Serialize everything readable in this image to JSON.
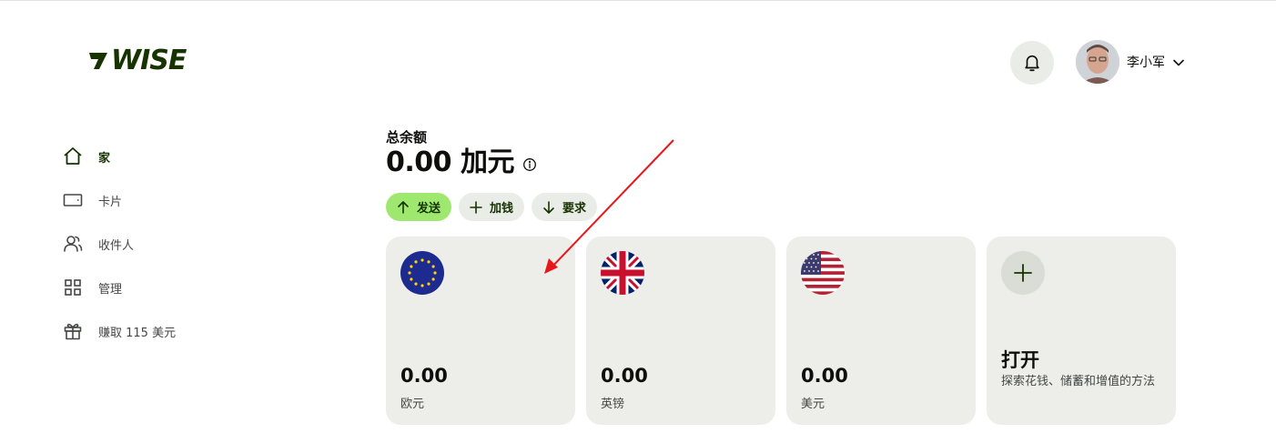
{
  "brand": {
    "name": "WISE",
    "color": "#163300",
    "accent": "#9fe870"
  },
  "header": {
    "user_name": "李小军"
  },
  "sidebar": {
    "items": [
      {
        "label": "家",
        "icon": "home-icon",
        "active": true
      },
      {
        "label": "卡片",
        "icon": "card-icon"
      },
      {
        "label": "收件人",
        "icon": "recipients-icon"
      },
      {
        "label": "管理",
        "icon": "grid-icon"
      },
      {
        "label": "赚取 115 美元",
        "icon": "gift-icon"
      }
    ]
  },
  "balance": {
    "label": "总余额",
    "amount": "0.00 加元"
  },
  "actions": {
    "send": "发送",
    "add": "加钱",
    "request": "要求"
  },
  "cards": [
    {
      "amount": "0.00",
      "currency": "欧元",
      "flag": "eu-flag-icon"
    },
    {
      "amount": "0.00",
      "currency": "英镑",
      "flag": "uk-flag-icon"
    },
    {
      "amount": "0.00",
      "currency": "美元",
      "flag": "us-flag-icon"
    }
  ],
  "open_card": {
    "title": "打开",
    "description": "探索花钱、储蓄和增值的方法"
  }
}
